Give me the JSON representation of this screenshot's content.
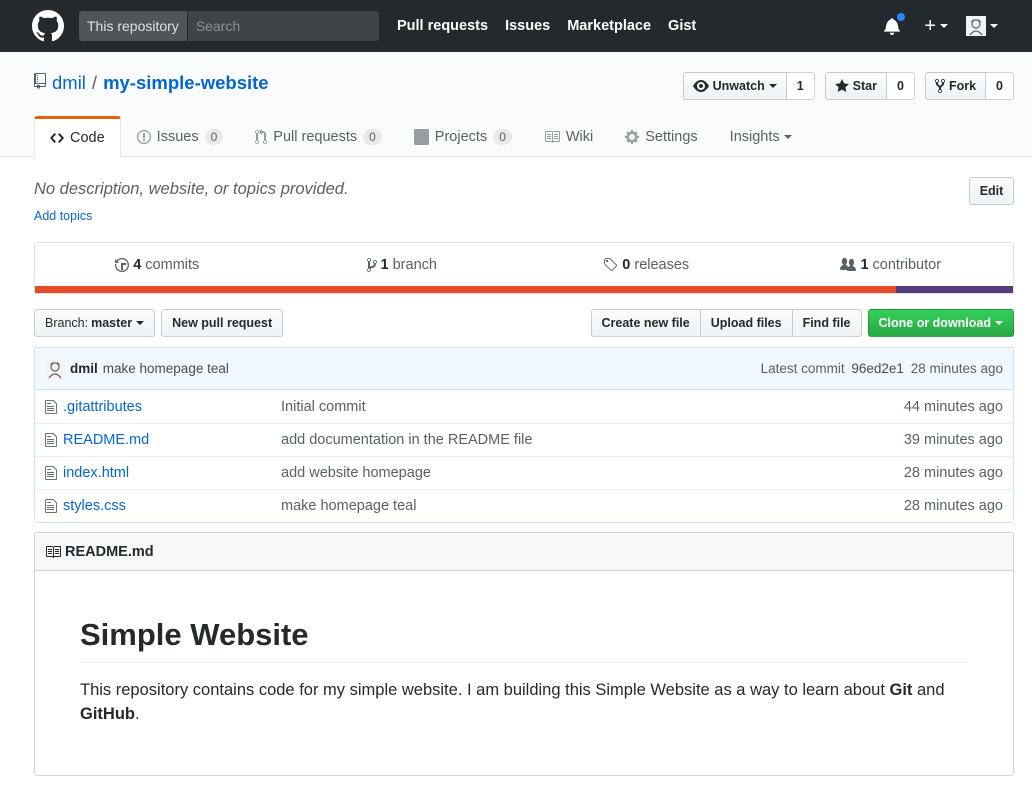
{
  "header": {
    "search_scope": "This repository",
    "search_placeholder": "Search",
    "nav": [
      "Pull requests",
      "Issues",
      "Marketplace",
      "Gist"
    ],
    "plus": "+"
  },
  "repo": {
    "owner": "dmil",
    "separator": "/",
    "name": "my-simple-website",
    "watch_label": "Unwatch",
    "watch_count": "1",
    "star_label": "Star",
    "star_count": "0",
    "fork_label": "Fork",
    "fork_count": "0"
  },
  "tabs": [
    {
      "label": "Code"
    },
    {
      "label": "Issues",
      "count": "0"
    },
    {
      "label": "Pull requests",
      "count": "0"
    },
    {
      "label": "Projects",
      "count": "0"
    },
    {
      "label": "Wiki"
    },
    {
      "label": "Settings"
    },
    {
      "label": "Insights"
    }
  ],
  "description": {
    "text": "No description, website, or topics provided.",
    "add_topics": "Add topics",
    "edit": "Edit"
  },
  "summary": {
    "commits_num": "4",
    "commits_label": "commits",
    "branch_num": "1",
    "branch_label": "branch",
    "releases_num": "0",
    "releases_label": "releases",
    "contributor_num": "1",
    "contributor_label": "contributor",
    "colors": {
      "html": "#e34c26",
      "css": "#563d7c"
    }
  },
  "filenav": {
    "branch_prefix": "Branch:",
    "branch": "master",
    "new_pr": "New pull request",
    "create_file": "Create new file",
    "upload": "Upload files",
    "find": "Find file",
    "clone": "Clone or download"
  },
  "commit": {
    "author": "dmil",
    "message": "make homepage teal",
    "latest_label": "Latest commit",
    "sha": "96ed2e1",
    "age": "28 minutes ago"
  },
  "files": [
    {
      "name": ".gitattributes",
      "message": "Initial commit",
      "age": "44 minutes ago"
    },
    {
      "name": "README.md",
      "message": "add documentation in the README file",
      "age": "39 minutes ago"
    },
    {
      "name": "index.html",
      "message": "add website homepage",
      "age": "28 minutes ago"
    },
    {
      "name": "styles.css",
      "message": "make homepage teal",
      "age": "28 minutes ago"
    }
  ],
  "readme": {
    "filename": "README.md",
    "heading": "Simple Website",
    "para_start": "This repository contains code for my simple website. I am building this Simple Website as a way to learn about ",
    "git": "Git",
    "and": " and ",
    "github": "GitHub",
    "period": "."
  }
}
